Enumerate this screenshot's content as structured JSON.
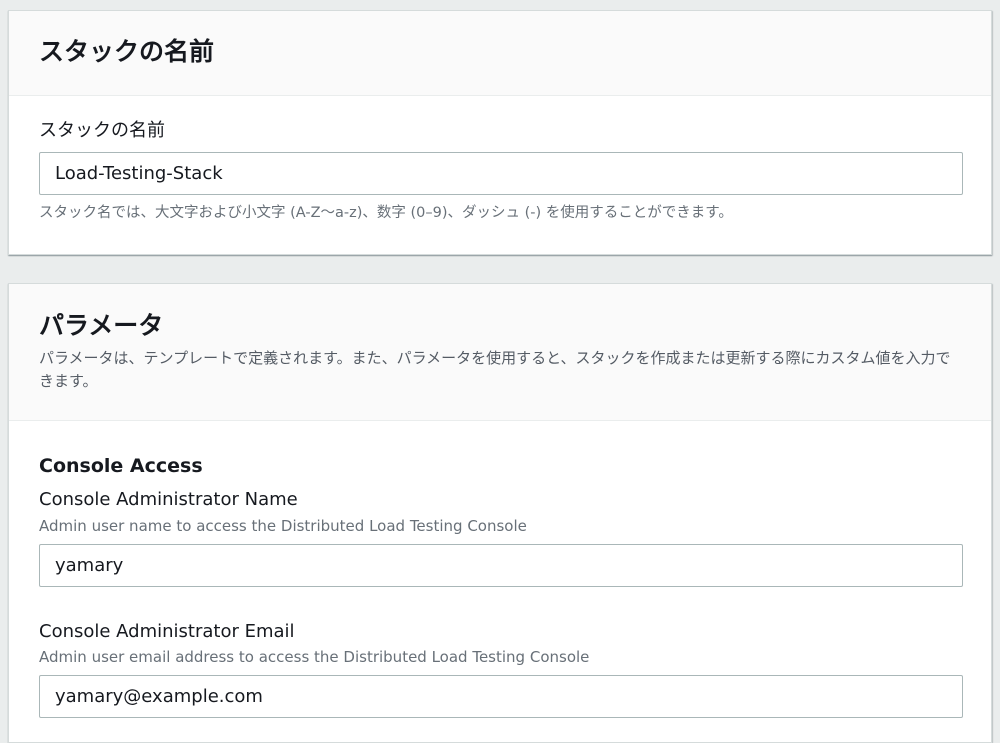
{
  "stack_panel": {
    "title": "スタックの名前",
    "field_label": "スタックの名前",
    "field_value": "Load-Testing-Stack",
    "constraint": "スタック名では、大文字および小文字 (A-Z〜a-z)、数字 (0–9)、ダッシュ (-) を使用することができます。"
  },
  "params_panel": {
    "title": "パラメータ",
    "description": "パラメータは、テンプレートで定義されます。また、パラメータを使用すると、スタックを作成または更新する際にカスタム値を入力できます。",
    "section_heading": "Console Access",
    "admin_name": {
      "label": "Console Administrator Name",
      "description": "Admin user name to access the Distributed Load Testing Console",
      "value": "yamary"
    },
    "admin_email": {
      "label": "Console Administrator Email",
      "description": "Admin user email address to access the Distributed Load Testing Console",
      "value": "yamary@example.com"
    }
  },
  "colors": {
    "page_bg": "#eaeded",
    "panel_bg": "#ffffff",
    "header_bg": "#fafafa",
    "text": "#16191f",
    "secondary_text": "#687078",
    "input_border": "#aab7b8"
  }
}
